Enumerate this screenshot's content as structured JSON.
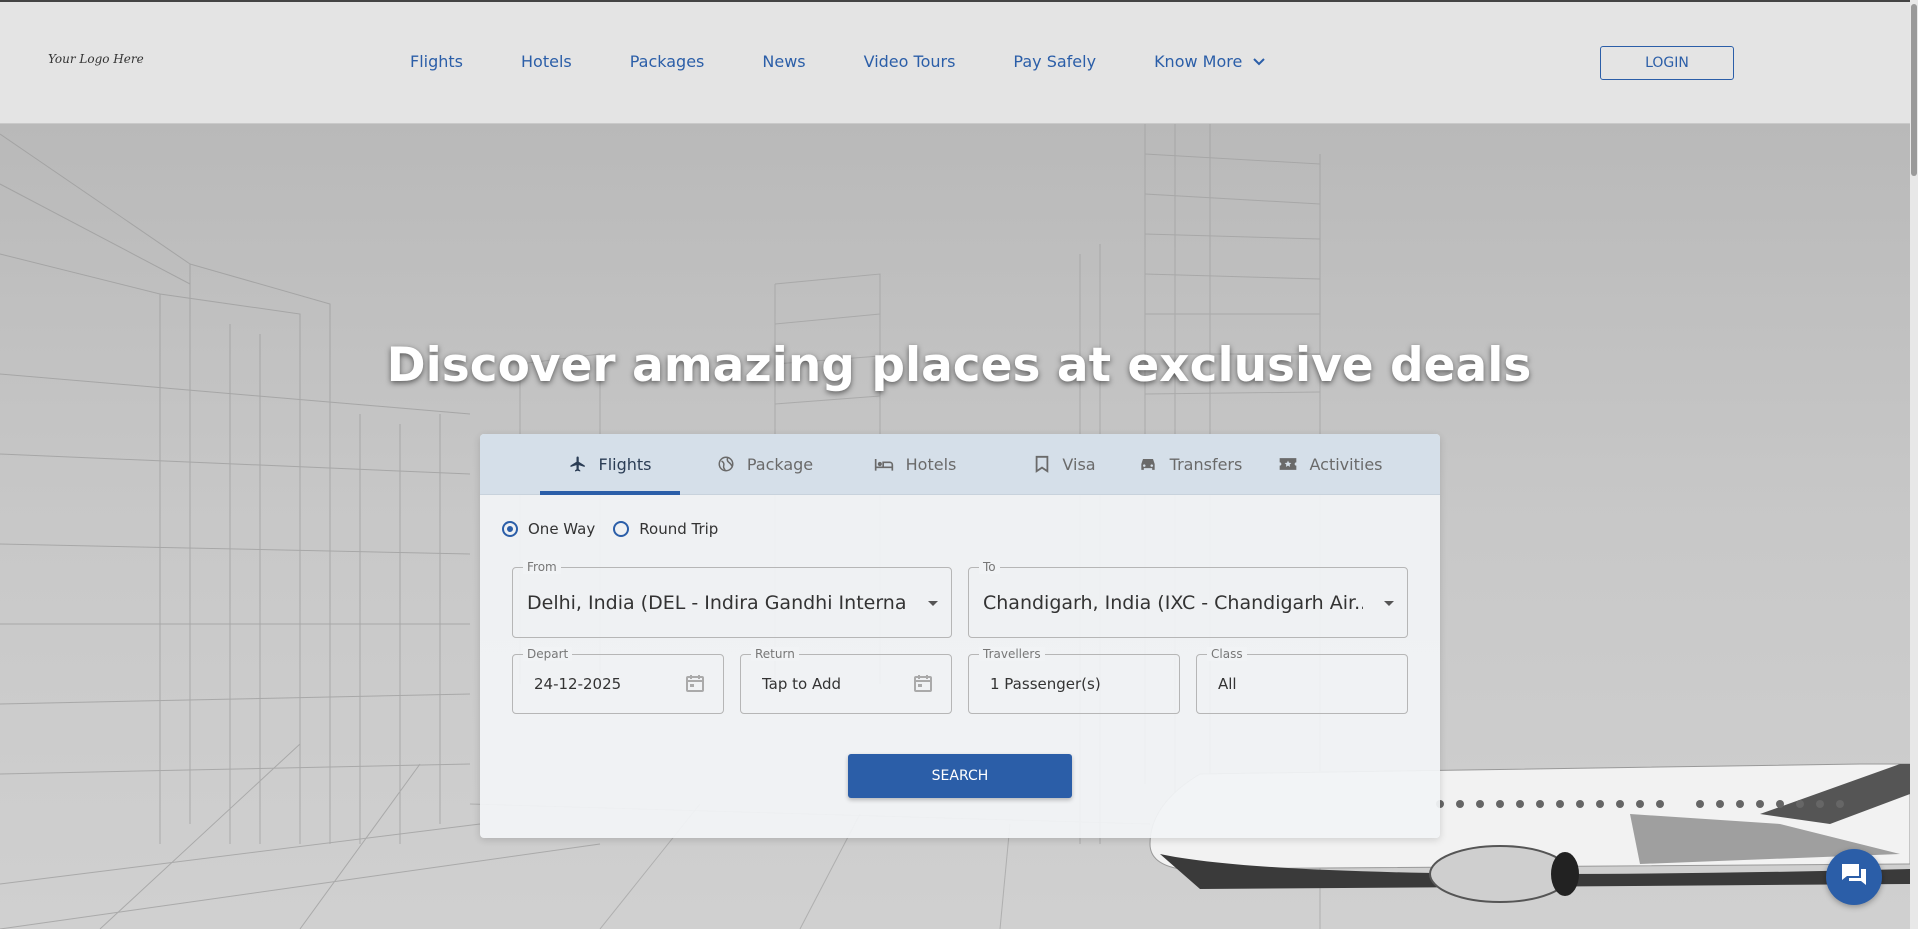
{
  "header": {
    "logo_text": "Your Logo Here",
    "nav": [
      "Flights",
      "Hotels",
      "Packages",
      "News",
      "Video Tours",
      "Pay Safely",
      "Know More"
    ],
    "login_label": "LOGIN"
  },
  "hero": {
    "title": "Discover amazing places at exclusive deals"
  },
  "search": {
    "tabs": [
      {
        "label": "Flights",
        "icon": "airplane-icon",
        "active": true
      },
      {
        "label": "Package",
        "icon": "globe-icon"
      },
      {
        "label": "Hotels",
        "icon": "bed-icon"
      },
      {
        "label": "Visa",
        "icon": "bookmark-icon"
      },
      {
        "label": "Transfers",
        "icon": "car-icon"
      },
      {
        "label": "Activities",
        "icon": "ticket-icon"
      }
    ],
    "trip_types": [
      {
        "label": "One Way",
        "selected": true
      },
      {
        "label": "Round Trip",
        "selected": false
      }
    ],
    "from": {
      "label": "From",
      "value": "Delhi, India (DEL - Indira Gandhi Interna..."
    },
    "to": {
      "label": "To",
      "value": "Chandigarh, India (IXC - Chandigarh Air..."
    },
    "depart": {
      "label": "Depart",
      "value": "24-12-2025"
    },
    "return": {
      "label": "Return",
      "value": "Tap to Add"
    },
    "travellers": {
      "label": "Travellers",
      "value": "1 Passenger(s)"
    },
    "class": {
      "label": "Class",
      "value": "All"
    },
    "search_label": "SEARCH"
  },
  "colors": {
    "accent": "#2b5ea8",
    "header_bg": "#e4e4e4",
    "tab_bar_bg": "#d5dfe9"
  },
  "chat": {
    "icon": "chat-icon"
  }
}
